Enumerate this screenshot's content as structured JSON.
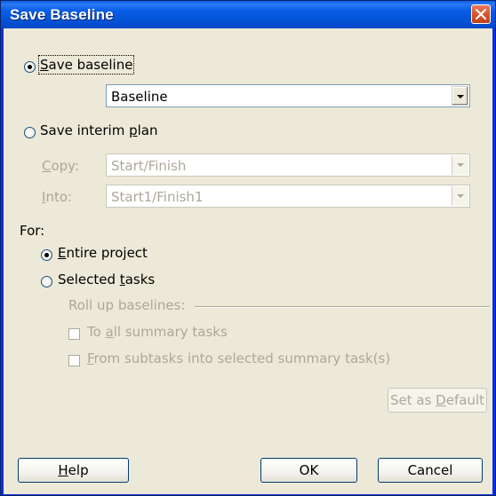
{
  "window": {
    "title": "Save Baseline"
  },
  "baseline_option": {
    "label_pre": "",
    "label_underline": "S",
    "label_post": "ave baseline",
    "selected": true
  },
  "baseline_select": {
    "value": "Baseline"
  },
  "interim_option": {
    "label_pre": "Save interim ",
    "label_underline": "p",
    "label_post": "lan",
    "selected": false
  },
  "copy": {
    "label_underline": "C",
    "label_post": "opy:",
    "value": "Start/Finish"
  },
  "into": {
    "label_underline": "I",
    "label_post": "nto:",
    "value": "Start1/Finish1"
  },
  "for": {
    "label": "For:",
    "entire": {
      "label_underline": "E",
      "label_post": "ntire project",
      "selected": true
    },
    "selected": {
      "label_pre": "Selected ",
      "label_underline": "t",
      "label_post": "asks",
      "selected": false
    }
  },
  "rollup": {
    "label": "Roll up baselines:",
    "to_all": {
      "label_pre": "To ",
      "label_underline": "a",
      "label_post": "ll summary tasks",
      "checked": false
    },
    "from_sub": {
      "label_underline": "F",
      "label_post": "rom subtasks into selected summary task(s)",
      "checked": false
    }
  },
  "buttons": {
    "set_default": {
      "pre": "Set as ",
      "underline": "D",
      "post": "efault"
    },
    "help": {
      "underline": "H",
      "post": "elp"
    },
    "ok": "OK",
    "cancel": "Cancel"
  }
}
